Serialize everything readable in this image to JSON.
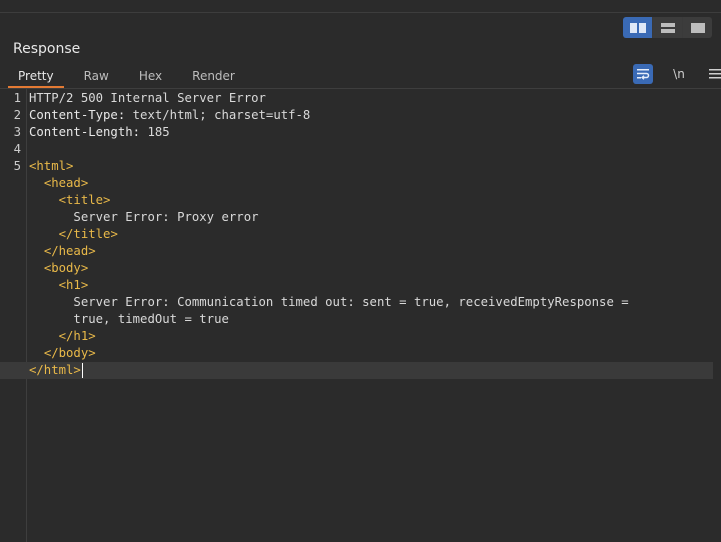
{
  "panel": {
    "title": "Response"
  },
  "view_toggle": [
    {
      "name": "split-horizontal",
      "active": true
    },
    {
      "name": "split-vertical",
      "active": false
    },
    {
      "name": "single-panel",
      "active": false
    }
  ],
  "tabs": [
    {
      "label": "Pretty",
      "active": true
    },
    {
      "label": "Raw",
      "active": false
    },
    {
      "label": "Hex",
      "active": false
    },
    {
      "label": "Render",
      "active": false
    }
  ],
  "tools": {
    "wrap_icon": "wrap-lines-icon",
    "newline_label": "\\n",
    "menu_icon": "hamburger-menu-icon"
  },
  "editor": {
    "lines": [
      {
        "num": "1",
        "text": "HTTP/2 500 Internal Server Error"
      },
      {
        "num": "2",
        "key": "Content-Type:",
        "value": " text/html; charset=utf-8"
      },
      {
        "num": "3",
        "key": "Content-Length:",
        "value": " 185"
      },
      {
        "num": "4",
        "text": ""
      },
      {
        "num": "5",
        "tag": "<html>"
      },
      {
        "num": "",
        "indent": "  ",
        "tag": "<head>"
      },
      {
        "num": "",
        "indent": "    ",
        "tag": "<title>"
      },
      {
        "num": "",
        "indent": "      ",
        "text": "Server Error: Proxy error"
      },
      {
        "num": "",
        "indent": "    ",
        "tag": "</title>"
      },
      {
        "num": "",
        "indent": "  ",
        "tag": "</head>"
      },
      {
        "num": "",
        "indent": "  ",
        "tag": "<body>"
      },
      {
        "num": "",
        "indent": "    ",
        "tag": "<h1>"
      },
      {
        "num": "",
        "indent": "      ",
        "text": "Server Error: Communication timed out: sent = true, receivedEmptyResponse ="
      },
      {
        "num": "",
        "indent": "      ",
        "text": "true, timedOut = true"
      },
      {
        "num": "",
        "indent": "    ",
        "tag": "</h1>"
      },
      {
        "num": "",
        "indent": "  ",
        "tag": "</body>"
      },
      {
        "num": "",
        "indent": "",
        "tag": "</html>",
        "current": true
      }
    ]
  },
  "colors": {
    "accent": "#3a6ab5",
    "tab_underline": "#e37a34",
    "tag": "#e9b949",
    "background": "#2b2b2b"
  }
}
